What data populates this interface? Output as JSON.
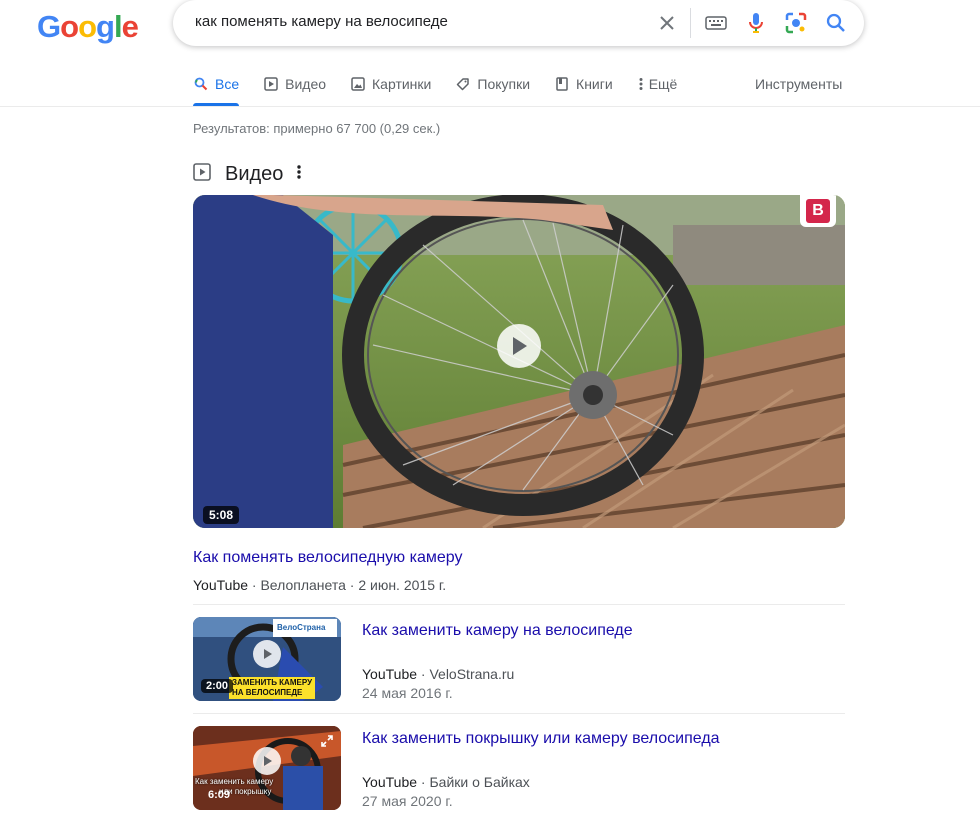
{
  "logo": {
    "letters": [
      "G",
      "o",
      "o",
      "g",
      "l",
      "e"
    ]
  },
  "search": {
    "query": "как поменять камеру на велосипеде"
  },
  "tabs": [
    {
      "label": "Все",
      "icon": "search-icon"
    },
    {
      "label": "Видео",
      "icon": "play-box-icon"
    },
    {
      "label": "Картинки",
      "icon": "image-icon"
    },
    {
      "label": "Покупки",
      "icon": "tag-icon"
    },
    {
      "label": "Книги",
      "icon": "book-icon"
    },
    {
      "label": "Ещё",
      "icon": "more-vert-icon"
    }
  ],
  "tools_label": "Инструменты",
  "stats": "Результатов: примерно 67 700 (0,29 сек.)",
  "video_section": {
    "title": "Видео"
  },
  "main_video": {
    "duration": "5:08",
    "title": "Как поменять велосипедную камеру",
    "source": "YouTube",
    "dot1": " · ",
    "channel": "Велопланета",
    "dot2": " · ",
    "date": "2 июн. 2015 г.",
    "badge": "B"
  },
  "videos": [
    {
      "duration": "2:00",
      "title": "Как заменить камеру на велосипеде",
      "source": "YouTube",
      "dot": " · ",
      "channel": "VeloStrana.ru",
      "date": "24 мая 2016 г.",
      "overlay_line1": "ЗАМЕНИТЬ КАМЕРУ",
      "overlay_line2": "НА ВЕЛОСИПЕДЕ",
      "brand": "ВелоСтрана"
    },
    {
      "duration": "6:09",
      "title": "Как заменить покрышку или камеру велосипеда",
      "source": "YouTube",
      "dot": " · ",
      "channel": "Байки о Байках",
      "date": "27 мая 2020 г.",
      "overlay_line1": "Как заменить камеру",
      "overlay_line2": "или покрышку"
    }
  ],
  "colors": {
    "link": "#1a0dab",
    "accent": "#1a73e8",
    "muted": "#70757a"
  }
}
